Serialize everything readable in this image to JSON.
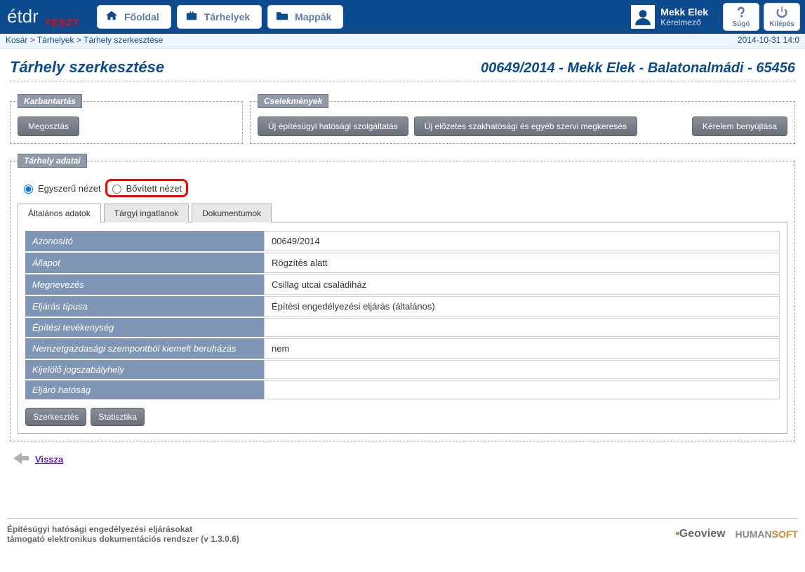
{
  "header": {
    "logo_teszt": "TESZT",
    "nav": {
      "home": "Főoldal",
      "storages": "Tárhelyek",
      "folders": "Mappák"
    },
    "user": {
      "name": "Mekk Elek",
      "role": "Kérelmező"
    },
    "help_label": "Súgó",
    "logout_label": "Kilépés"
  },
  "breadcrumb": {
    "items": [
      "Kosár",
      "Tárhelyek",
      "Tárhely szerkesztése"
    ],
    "separator": " > ",
    "timestamp": "2014-10-31 14:0"
  },
  "title": {
    "page": "Tárhely szerkesztése",
    "context": "00649/2014 - Mekk Elek - Balatonalmádi - 65456"
  },
  "panels": {
    "maintenance": {
      "legend": "Karbantartás",
      "share_btn": "Megosztás"
    },
    "actions": {
      "legend": "Cselekmények",
      "btn1": "Új építésügyi hatósági szolgáltatás",
      "btn2": "Új előzetes szakhatósági és egyéb szervi megkeresés",
      "btn3": "Kérelem benyújtása"
    },
    "data": {
      "legend": "Tárhely adatai"
    }
  },
  "viewmode": {
    "simple": "Egyszerű nézet",
    "extended": "Bővített nézet"
  },
  "tabs": {
    "general": "Általános adatok",
    "realestate": "Tárgyi ingatlanok",
    "documents": "Dokumentumok"
  },
  "fields": {
    "id": {
      "label": "Azonosító",
      "value": "00649/2014"
    },
    "status": {
      "label": "Állapot",
      "value": "Rögzítés alatt"
    },
    "name": {
      "label": "Megnevezés",
      "value": "Csillag utcai családiház"
    },
    "proc_type": {
      "label": "Eljárás típusa",
      "value": "Építési engedélyezési eljárás (általános)"
    },
    "activity": {
      "label": "Építési tevékenység",
      "value": ""
    },
    "priority": {
      "label": "Nemzetgazdasági szempontból kiemelt beruházás",
      "value": "nem"
    },
    "lawref": {
      "label": "Kijelölő jogszabályhely",
      "value": ""
    },
    "authority": {
      "label": "Eljáró hatóság",
      "value": ""
    }
  },
  "buttons": {
    "edit": "Szerkesztés",
    "stats": "Statisztika"
  },
  "back": "Vissza",
  "footer": {
    "line1": "Építésügyi hatósági engedélyezési eljárásokat",
    "line2": "támogató elektronikus dokumentációs rendszer (v 1.3.0.6)"
  }
}
